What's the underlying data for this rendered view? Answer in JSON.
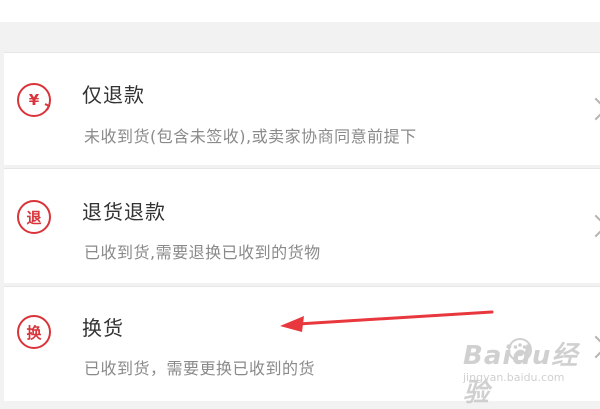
{
  "options": [
    {
      "icon": "refund-yen-icon",
      "icon_glyph": "¥",
      "title": "仅退款",
      "description": "未收到货(包含未签收),或卖家协商同意前提下"
    },
    {
      "icon": "return-icon",
      "icon_glyph": "退",
      "title": "退货退款",
      "description": "已收到货,需要退换已收到的货物"
    },
    {
      "icon": "exchange-icon",
      "icon_glyph": "换",
      "title": "换货",
      "description": "已收到货，需要更换已收到的货"
    }
  ],
  "watermark": {
    "main": "Baidu经验",
    "sub": "jingyan.baidu.com"
  },
  "colors": {
    "accent": "#d9343a",
    "annotation_arrow": "#e8383d"
  }
}
